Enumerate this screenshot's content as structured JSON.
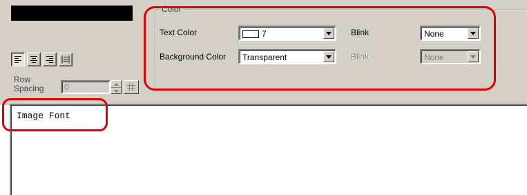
{
  "color_group": {
    "title": "Color",
    "text_color_label": "Text Color",
    "text_color_value": "7",
    "background_color_label": "Background Color",
    "background_color_value": "Transparent",
    "blink_label": "Blink",
    "blink_value": "None",
    "blink2_label": "Blink",
    "blink2_value": "None"
  },
  "row_spacing": {
    "label_line1": "Row",
    "label_line2": "Spacing",
    "value": "0"
  },
  "preview": {
    "text": "Image Font"
  },
  "colors": {
    "highlight": "#e00000",
    "panel": "#d4d0c8"
  },
  "icons": [
    "align-left-icon",
    "align-center-icon",
    "align-right-icon",
    "align-justify-icon",
    "spin-up-icon",
    "spin-down-icon",
    "grid-icon",
    "dropdown-arrow-icon"
  ]
}
